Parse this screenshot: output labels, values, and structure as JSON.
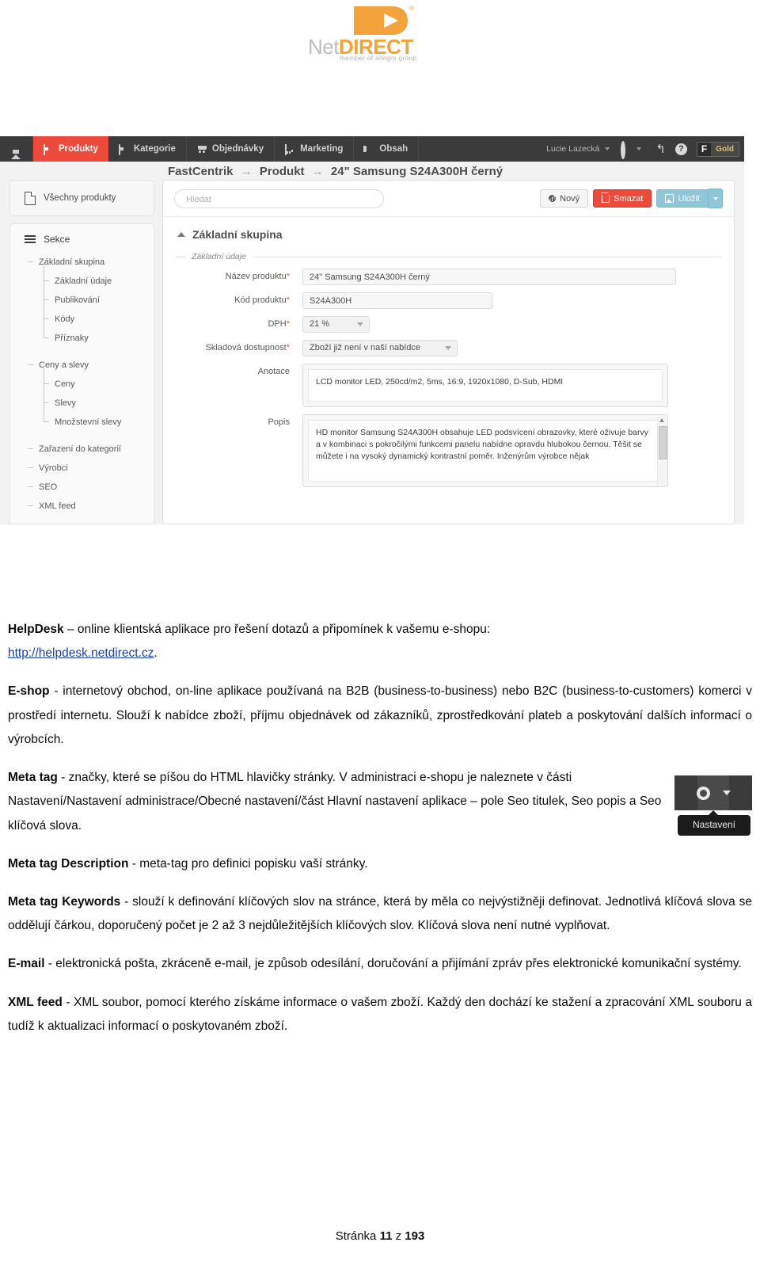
{
  "logo": {
    "net": "Net",
    "direct": "DIRECT",
    "registered": "®",
    "tagline": "member of allegro group"
  },
  "screenshot": {
    "topnav": {
      "items": [
        {
          "label": "",
          "icon": "home-icon",
          "active": false
        },
        {
          "label": "Produkty",
          "icon": "product-card-icon",
          "active": true
        },
        {
          "label": "Kategorie",
          "icon": "category-icon",
          "active": false
        },
        {
          "label": "Objednávky",
          "icon": "cart-icon",
          "active": false
        },
        {
          "label": "Marketing",
          "icon": "chart-icon",
          "active": false
        },
        {
          "label": "Obsah",
          "icon": "content-icon",
          "active": false
        }
      ],
      "user": "Lucie Lazecká",
      "gear_icon": "gear-icon",
      "undo_icon": "undo-icon",
      "help_icon": "help-icon",
      "badge_letter": "F",
      "badge_text": "Gold"
    },
    "breadcrumb": {
      "root": "FastCentrik",
      "level2": "Produkt",
      "level3": "24\" Samsung S24A300H černý",
      "separator": "→"
    },
    "all_products_label": "Všechny produkty",
    "sections": {
      "title": "Sekce",
      "items": [
        {
          "label": "Základní skupina",
          "level": 1,
          "gap": false
        },
        {
          "label": "Základní údaje",
          "level": 2,
          "gap": false
        },
        {
          "label": "Publikování",
          "level": 2,
          "gap": false
        },
        {
          "label": "Kódy",
          "level": 2,
          "gap": false
        },
        {
          "label": "Příznaky",
          "level": 2,
          "gap": false
        },
        {
          "label": "Ceny a slevy",
          "level": 1,
          "gap": true
        },
        {
          "label": "Ceny",
          "level": 2,
          "gap": false
        },
        {
          "label": "Slevy",
          "level": 2,
          "gap": false
        },
        {
          "label": "Množstevní slevy",
          "level": 2,
          "gap": false
        },
        {
          "label": "Zařazení do kategorií",
          "level": 1,
          "gap": true
        },
        {
          "label": "Výrobci",
          "level": 1,
          "gap": false
        },
        {
          "label": "SEO",
          "level": 1,
          "gap": false
        },
        {
          "label": "XML feed",
          "level": 1,
          "gap": false
        }
      ]
    },
    "toolbar": {
      "search_placeholder": "Hledat",
      "new_label": "Nový",
      "delete_label": "Smazat",
      "save_label": "Uložit"
    },
    "group_title": "Základní skupina",
    "fieldset_legend": "Základní údaje",
    "fields": {
      "name_label": "Název produktu",
      "name_value": "24\" Samsung S24A300H černý",
      "code_label": "Kód produktu",
      "code_value": "S24A300H",
      "vat_label": "DPH",
      "vat_value": "21 %",
      "stock_label": "Skladová dostupnost",
      "stock_value": "Zboží již není v naší nabídce",
      "annotation_label": "Anotace",
      "annotation_value": "LCD monitor LED, 250cd/m2, 5ms, 16:9, 1920x1080, D-Sub, HDMI",
      "description_label": "Popis",
      "description_value": "HD monitor Samsung S24A300H obsahuje LED podsvícení obrazovky, které oživuje barvy a v kombinaci s pokročilými funkcemi panelu nabídne opravdu hlubokou černou. Těšit se můžete i na vysoký dynamický kontrastní poměr. Inženýrům výrobce nějak",
      "required_marker": "*"
    }
  },
  "body": {
    "p1_term": "HelpDesk",
    "p1_text": " – online klientská aplikace pro řešení dotazů a připomínek k vašemu e-shopu:",
    "p1_link": "http://helpdesk.netdirect.cz",
    "p1_link_after": ".",
    "p2_term": "E-shop",
    "p2_text": " - internetový obchod, on-line aplikace používaná na B2B (business-to-business) nebo B2C (business-to-customers) komerci v prostředí internetu. Slouží k nabídce zboží, příjmu objednávek od zákazníků, zprostředkování plateb a poskytování dalších informací o výrobcích.",
    "p3_term": "Meta tag",
    "p3_text": " - značky, které se píšou do HTML hlavičky stránky. V administraci e-shopu je naleznete v části Nastavení/Nastavení administrace/Obecné nastavení/část Hlavní nastavení aplikace – pole Seo titulek, Seo popis a Seo klíčová slova.",
    "nastaveni_tooltip": "Nastavení",
    "p4_term": "Meta tag Description",
    "p4_text": " - meta-tag pro definici popisku vaší stránky.",
    "p5_term": "Meta tag Keywords",
    "p5_text": " - slouží k definování klíčových slov na stránce, která by měla co nejvýstižněji definovat. Jednotlivá klíčová slova se oddělují čárkou, doporučený počet je 2 až 3 nejdůležitějších klíčových slov. Klíčová slova není nutné vyplňovat.",
    "p6_term": "E-mail",
    "p6_text": " - elektronická pošta, zkráceně e-mail, je způsob odesílání, doručování a přijímání zpráv přes elektronické komunikační systémy.",
    "p7_term": "XML feed",
    "p7_text": " - XML soubor, pomocí kterého získáme informace o vašem zboží. Každý den dochází ke stažení a zpracování XML souboru a tudíž k aktualizaci informací o poskytovaném zboží."
  },
  "footer": {
    "prefix": "Stránka ",
    "page": "11",
    "middle": " z ",
    "total": "193"
  },
  "colors": {
    "brand_orange": "#f2a33c",
    "nav_dark": "#3b3b3b",
    "accent_red": "#ec4b3b",
    "save_blue": "#8fc6d8",
    "link_blue": "#1d41a8"
  }
}
